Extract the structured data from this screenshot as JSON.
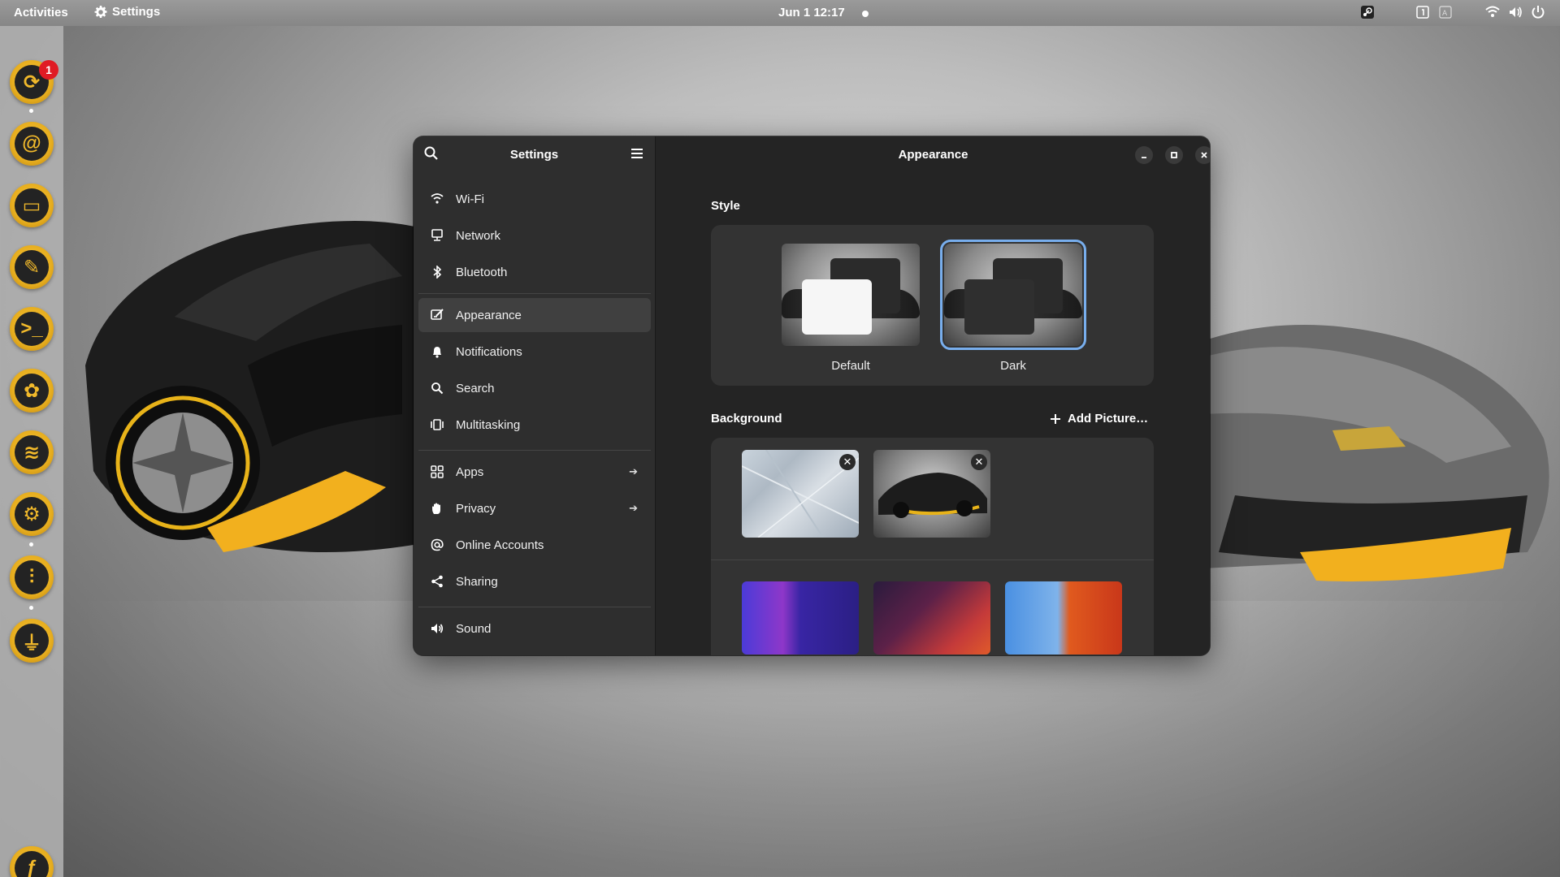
{
  "topbar": {
    "activities": "Activities",
    "app_name": "Settings",
    "clock": "Jun 1  12:17",
    "tray_icons": [
      "steam-icon",
      "workspace-1-icon",
      "input-indicator-icon",
      "wifi-icon",
      "volume-icon",
      "power-icon"
    ]
  },
  "dock": {
    "apps": [
      {
        "name": "updates-app-icon",
        "badge": "1"
      },
      {
        "name": "mail-app-icon"
      },
      {
        "name": "files-app-icon"
      },
      {
        "name": "tools-app-icon"
      },
      {
        "name": "terminal-app-icon"
      },
      {
        "name": "gimp-app-icon"
      },
      {
        "name": "spotify-app-icon"
      },
      {
        "name": "steam-app-icon"
      },
      {
        "name": "mixer-app-icon"
      },
      {
        "name": "usb-app-icon"
      },
      {
        "name": "fedora-app-icon"
      }
    ]
  },
  "sidebar": {
    "title": "Settings",
    "items": [
      {
        "label": "Wi-Fi",
        "icon": "wifi-icon"
      },
      {
        "label": "Network",
        "icon": "network-icon"
      },
      {
        "label": "Bluetooth",
        "icon": "bluetooth-icon"
      },
      {
        "label": "Appearance",
        "icon": "appearance-icon",
        "active": true
      },
      {
        "label": "Notifications",
        "icon": "bell-icon"
      },
      {
        "label": "Search",
        "icon": "search-icon"
      },
      {
        "label": "Multitasking",
        "icon": "multitasking-icon"
      },
      {
        "label": "Apps",
        "icon": "apps-icon",
        "has_arrow": true
      },
      {
        "label": "Privacy",
        "icon": "hand-icon",
        "has_arrow": true
      },
      {
        "label": "Online Accounts",
        "icon": "at-icon"
      },
      {
        "label": "Sharing",
        "icon": "share-icon"
      },
      {
        "label": "Sound",
        "icon": "sound-icon"
      }
    ]
  },
  "content": {
    "title": "Appearance",
    "style": {
      "section_title": "Style",
      "options": [
        {
          "label": "Default",
          "selected": false
        },
        {
          "label": "Dark",
          "selected": true
        }
      ]
    },
    "background": {
      "section_title": "Background",
      "add_picture": "Add Picture…"
    }
  },
  "colors": {
    "accent": "#78aeed",
    "dock_icon": "#f0b72a",
    "window_bg": "#242424",
    "sidebar_bg": "#2e2e2e",
    "card_bg": "#333333"
  }
}
